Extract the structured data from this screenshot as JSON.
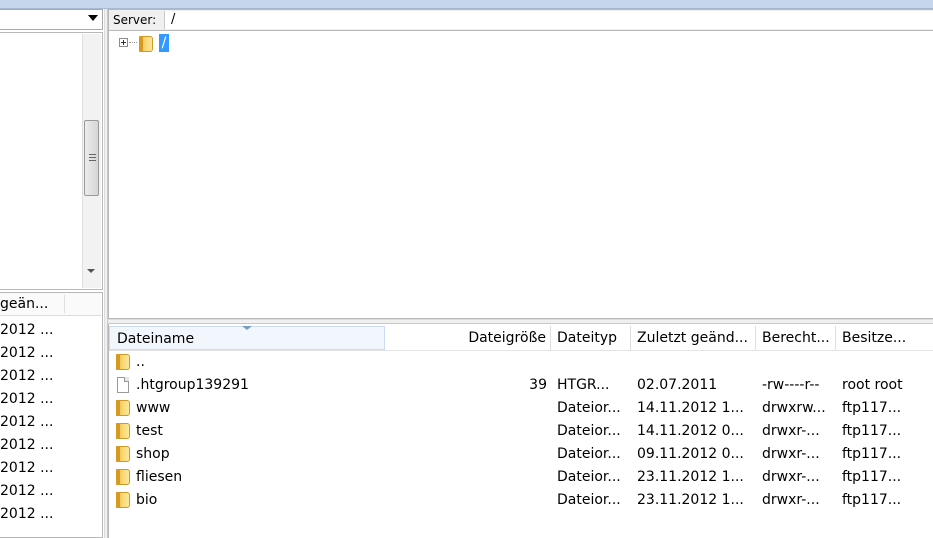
{
  "server_bar": {
    "label": "Server:",
    "path": "/"
  },
  "remote_tree": {
    "root_label": "/"
  },
  "local_list": {
    "column_modified": "geän...",
    "rows": [
      "2012 ...",
      "2012 ...",
      "2012 ...",
      "2012 ...",
      "2012 ...",
      "2012 ...",
      "2012 ...",
      "2012 ...",
      "2012 ..."
    ]
  },
  "remote_list": {
    "columns": {
      "name": "Dateiname",
      "size": "Dateigröße",
      "type": "Dateityp",
      "modified": "Zuletzt geänd...",
      "permissions": "Berecht...",
      "owner": "Besitze..."
    },
    "rows": [
      {
        "icon": "folder-icon",
        "name": "..",
        "size": "",
        "type": "",
        "modified": "",
        "permissions": "",
        "owner": ""
      },
      {
        "icon": "file-icon",
        "name": ".htgroup139291",
        "size": "39",
        "type": "HTGR...",
        "modified": "02.07.2011",
        "permissions": "-rw----r--",
        "owner": "root root"
      },
      {
        "icon": "folder-icon",
        "name": "www",
        "size": "",
        "type": "Dateior...",
        "modified": "14.11.2012 1...",
        "permissions": "drwxrw...",
        "owner": "ftp117..."
      },
      {
        "icon": "folder-icon",
        "name": "test",
        "size": "",
        "type": "Dateior...",
        "modified": "14.11.2012 0...",
        "permissions": "drwxr-...",
        "owner": "ftp117..."
      },
      {
        "icon": "folder-icon",
        "name": "shop",
        "size": "",
        "type": "Dateior...",
        "modified": "09.11.2012 0...",
        "permissions": "drwxr-...",
        "owner": "ftp117..."
      },
      {
        "icon": "folder-icon",
        "name": "fliesen",
        "size": "",
        "type": "Dateior...",
        "modified": "23.11.2012 1...",
        "permissions": "drwxr-...",
        "owner": "ftp117..."
      },
      {
        "icon": "folder-icon",
        "name": "bio",
        "size": "",
        "type": "Dateior...",
        "modified": "23.11.2012 1...",
        "permissions": "drwxr-...",
        "owner": "ftp117..."
      }
    ]
  }
}
